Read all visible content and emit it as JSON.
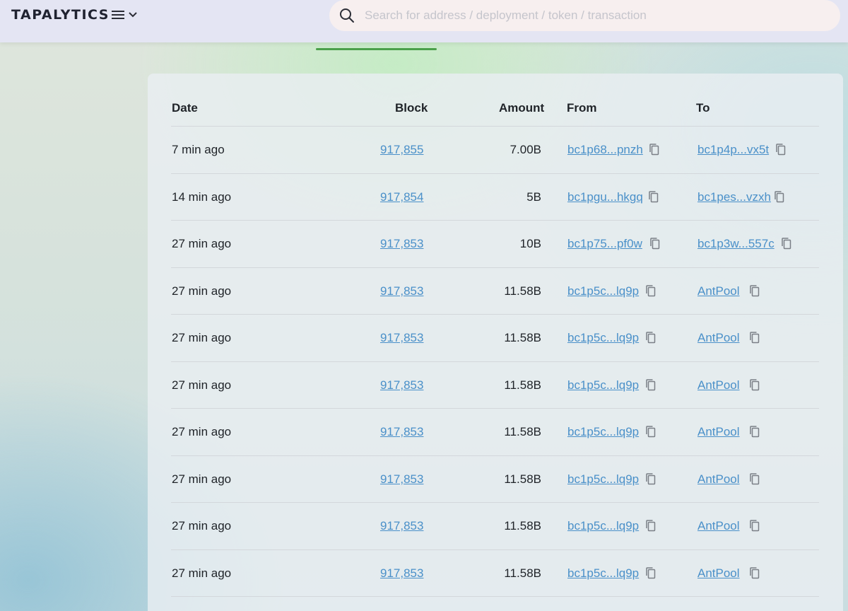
{
  "header": {
    "logo_text": "TAPALYTICS",
    "menu_icon": "hamburger-icon",
    "menu_chevron_icon": "chevron-down-icon",
    "search": {
      "placeholder": "Search for address / deployment / token / transaction",
      "value": "",
      "icon": "search-icon"
    }
  },
  "table": {
    "columns": [
      "Date",
      "Block",
      "Amount",
      "From",
      "To"
    ],
    "rows": [
      {
        "date": "7 min ago",
        "block": "917,855",
        "amount": "7.00B",
        "from": "bc1p68...pnzh",
        "to": "bc1p4p...vx5t"
      },
      {
        "date": "14 min ago",
        "block": "917,854",
        "amount": "5B",
        "from": "bc1pgu...hkgq",
        "to": "bc1pes...vzxh"
      },
      {
        "date": "27 min ago",
        "block": "917,853",
        "amount": "10B",
        "from": "bc1p75...pf0w",
        "to": "bc1p3w...557c"
      },
      {
        "date": "27 min ago",
        "block": "917,853",
        "amount": "11.58B",
        "from": "bc1p5c...lq9p",
        "to": "AntPool"
      },
      {
        "date": "27 min ago",
        "block": "917,853",
        "amount": "11.58B",
        "from": "bc1p5c...lq9p",
        "to": "AntPool"
      },
      {
        "date": "27 min ago",
        "block": "917,853",
        "amount": "11.58B",
        "from": "bc1p5c...lq9p",
        "to": "AntPool"
      },
      {
        "date": "27 min ago",
        "block": "917,853",
        "amount": "11.58B",
        "from": "bc1p5c...lq9p",
        "to": "AntPool"
      },
      {
        "date": "27 min ago",
        "block": "917,853",
        "amount": "11.58B",
        "from": "bc1p5c...lq9p",
        "to": "AntPool"
      },
      {
        "date": "27 min ago",
        "block": "917,853",
        "amount": "11.58B",
        "from": "bc1p5c...lq9p",
        "to": "AntPool"
      },
      {
        "date": "27 min ago",
        "block": "917,853",
        "amount": "11.58B",
        "from": "bc1p5c...lq9p",
        "to": "AntPool"
      }
    ],
    "copy_icon": "copy-icon"
  },
  "colors": {
    "link": "#4a90c9",
    "tab_indicator": "#4aa04a",
    "header_bg": "#e4e5f3"
  }
}
